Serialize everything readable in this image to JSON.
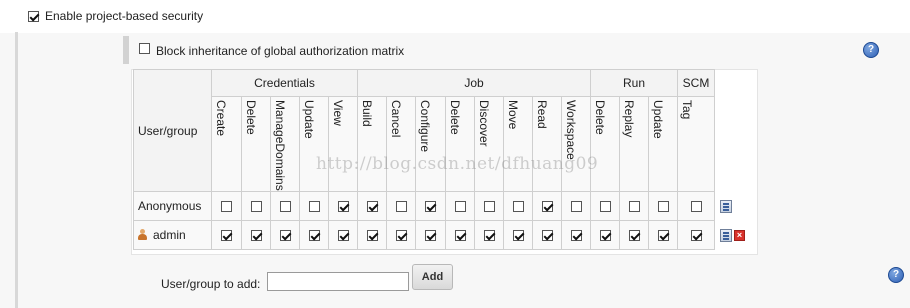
{
  "security": {
    "enable_label": "Enable project-based security",
    "enable_checked": true,
    "block_label": "Block inheritance of global authorization matrix",
    "block_checked": false,
    "help_glyph": "?"
  },
  "matrix": {
    "user_group_header": "User/group",
    "groups": [
      {
        "label": "Credentials",
        "span": 5
      },
      {
        "label": "Job",
        "span": 8
      },
      {
        "label": "Run",
        "span": 3
      },
      {
        "label": "SCM",
        "span": 1
      }
    ],
    "permissions": [
      "Create",
      "Delete",
      "ManageDomains",
      "Update",
      "View",
      "Build",
      "Cancel",
      "Configure",
      "Delete",
      "Discover",
      "Move",
      "Read",
      "Workspace",
      "Delete",
      "Replay",
      "Update",
      "Tag"
    ],
    "rows": [
      {
        "name": "Anonymous",
        "icon": "",
        "checks": [
          false,
          false,
          false,
          false,
          true,
          true,
          false,
          true,
          false,
          false,
          false,
          true,
          false,
          false,
          false,
          false,
          false
        ],
        "actions": [
          "configure-icon"
        ]
      },
      {
        "name": "admin",
        "icon": "user-icon",
        "checks": [
          true,
          true,
          true,
          true,
          true,
          true,
          true,
          true,
          true,
          true,
          true,
          true,
          true,
          true,
          true,
          true,
          true
        ],
        "actions": [
          "configure-icon",
          "delete-icon"
        ]
      }
    ]
  },
  "watermark": "http://blog.csdn.net/dfhuang09",
  "add": {
    "label": "User/group to add:",
    "input_value": "",
    "button_label": "Add"
  }
}
